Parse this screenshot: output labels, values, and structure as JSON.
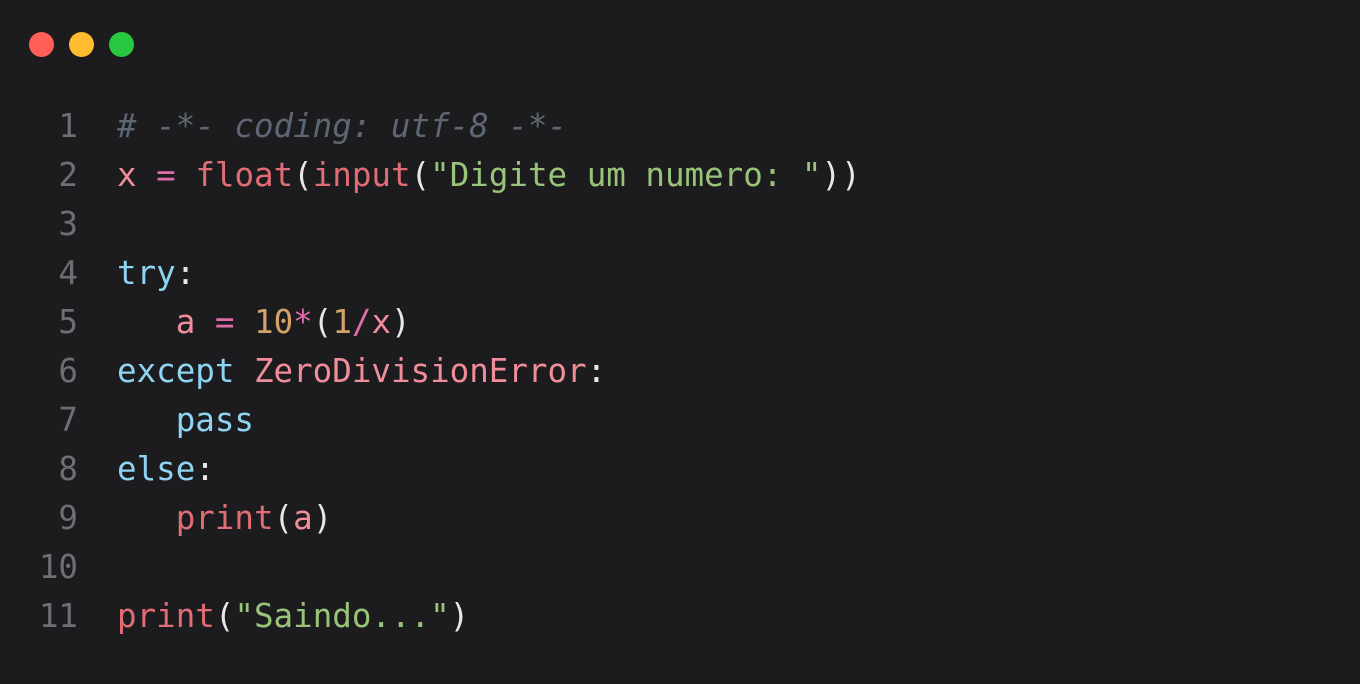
{
  "window": {
    "controls": [
      {
        "name": "close",
        "color": "#ff5f57"
      },
      {
        "name": "minimize",
        "color": "#febc2e"
      },
      {
        "name": "maximize",
        "color": "#28c840"
      }
    ]
  },
  "code": {
    "language": "python",
    "lines": [
      {
        "number": "1",
        "tokens": [
          {
            "t": "# -*- coding: utf-8 -*-",
            "c": "comment"
          }
        ]
      },
      {
        "number": "2",
        "tokens": [
          {
            "t": "x",
            "c": "var"
          },
          {
            "t": " ",
            "c": "punc"
          },
          {
            "t": "=",
            "c": "op"
          },
          {
            "t": " ",
            "c": "punc"
          },
          {
            "t": "float",
            "c": "func"
          },
          {
            "t": "(",
            "c": "punc"
          },
          {
            "t": "input",
            "c": "func"
          },
          {
            "t": "(",
            "c": "punc"
          },
          {
            "t": "\"Digite um numero: \"",
            "c": "str"
          },
          {
            "t": "))",
            "c": "punc"
          }
        ]
      },
      {
        "number": "3",
        "tokens": []
      },
      {
        "number": "4",
        "tokens": [
          {
            "t": "try",
            "c": "keyword"
          },
          {
            "t": ":",
            "c": "punc"
          }
        ]
      },
      {
        "number": "5",
        "tokens": [
          {
            "t": "   ",
            "c": "punc"
          },
          {
            "t": "a",
            "c": "var"
          },
          {
            "t": " ",
            "c": "punc"
          },
          {
            "t": "=",
            "c": "op"
          },
          {
            "t": " ",
            "c": "punc"
          },
          {
            "t": "10",
            "c": "num"
          },
          {
            "t": "*",
            "c": "op"
          },
          {
            "t": "(",
            "c": "punc"
          },
          {
            "t": "1",
            "c": "num"
          },
          {
            "t": "/",
            "c": "op"
          },
          {
            "t": "x",
            "c": "var"
          },
          {
            "t": ")",
            "c": "punc"
          }
        ]
      },
      {
        "number": "6",
        "tokens": [
          {
            "t": "except",
            "c": "keyword"
          },
          {
            "t": " ",
            "c": "punc"
          },
          {
            "t": "ZeroDivisionError",
            "c": "class"
          },
          {
            "t": ":",
            "c": "punc"
          }
        ]
      },
      {
        "number": "7",
        "tokens": [
          {
            "t": "   ",
            "c": "punc"
          },
          {
            "t": "pass",
            "c": "keyword"
          }
        ]
      },
      {
        "number": "8",
        "tokens": [
          {
            "t": "else",
            "c": "keyword"
          },
          {
            "t": ":",
            "c": "punc"
          }
        ]
      },
      {
        "number": "9",
        "tokens": [
          {
            "t": "   ",
            "c": "punc"
          },
          {
            "t": "print",
            "c": "func"
          },
          {
            "t": "(",
            "c": "punc"
          },
          {
            "t": "a",
            "c": "var"
          },
          {
            "t": ")",
            "c": "punc"
          }
        ]
      },
      {
        "number": "10",
        "tokens": []
      },
      {
        "number": "11",
        "tokens": [
          {
            "t": "print",
            "c": "func"
          },
          {
            "t": "(",
            "c": "punc"
          },
          {
            "t": "\"Saindo...\"",
            "c": "str"
          },
          {
            "t": ")",
            "c": "punc"
          }
        ]
      }
    ]
  }
}
